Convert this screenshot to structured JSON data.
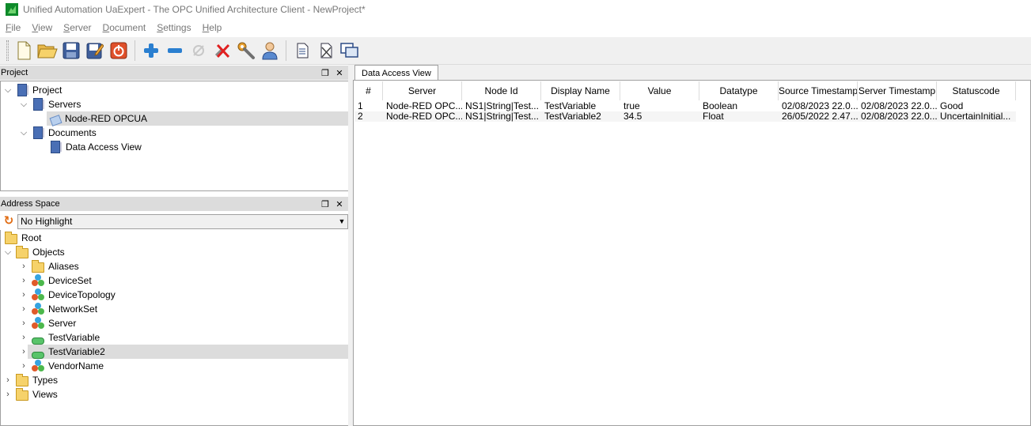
{
  "window": {
    "title": "Unified Automation UaExpert - The OPC Unified Architecture Client - NewProject*"
  },
  "menu": [
    {
      "first": "F",
      "rest": "ile"
    },
    {
      "first": "V",
      "rest": "iew"
    },
    {
      "first": "S",
      "rest": "erver"
    },
    {
      "first": "D",
      "rest": "ocument"
    },
    {
      "first": "S",
      "rest": "ettings"
    },
    {
      "first": "H",
      "rest": "elp"
    }
  ],
  "toolbar": {
    "icons": [
      "new-project-icon",
      "open-project-icon",
      "save-project-icon",
      "save-as-icon",
      "exit-icon",
      "add-server-icon",
      "remove-server-icon",
      "connect-icon",
      "disconnect-icon",
      "settings-icon",
      "user-icon",
      "add-document-icon",
      "remove-document-icon",
      "windows-icon"
    ]
  },
  "project_panel": {
    "title": "Project",
    "tree": {
      "root": "Project",
      "servers": "Servers",
      "server_item": "Node-RED OPCUA",
      "documents": "Documents",
      "document_item": "Data Access View"
    }
  },
  "address_panel": {
    "title": "Address Space",
    "highlight": "No Highlight",
    "tree": {
      "root": "Root",
      "objects": "Objects",
      "children": [
        "Aliases",
        "DeviceSet",
        "DeviceTopology",
        "NetworkSet",
        "Server",
        "TestVariable",
        "TestVariable2",
        "VendorName"
      ],
      "types": "Types",
      "views": "Views"
    }
  },
  "tab": {
    "label": "Data Access View"
  },
  "table": {
    "columns": [
      "#",
      "Server",
      "Node Id",
      "Display Name",
      "Value",
      "Datatype",
      "Source Timestamp",
      "Server Timestamp",
      "Statuscode"
    ],
    "rows": [
      [
        "1",
        "Node-RED OPC...",
        "NS1|String|Test...",
        "TestVariable",
        "true",
        "Boolean",
        "02/08/2023 22.0...",
        "02/08/2023 22.0...",
        "Good"
      ],
      [
        "2",
        "Node-RED OPC...",
        "NS1|String|Test...",
        "TestVariable2",
        "34.5",
        "Float",
        "26/05/2022 2.47...",
        "02/08/2023 22.0...",
        "UncertainInitial..."
      ]
    ]
  },
  "colors": {
    "selection": "#dcdcdc",
    "panel_header": "#dcdcdc",
    "toolbar_bg": "#f0f0f0"
  }
}
